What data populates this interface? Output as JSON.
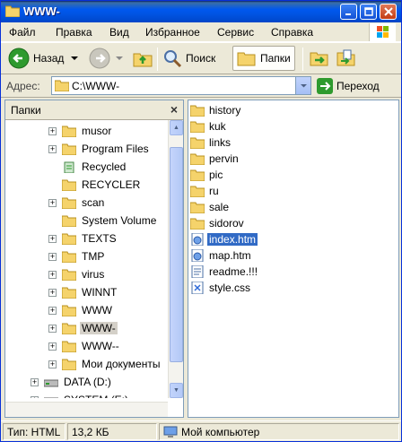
{
  "window": {
    "title": "WWW-"
  },
  "menu": {
    "items": [
      "Файл",
      "Правка",
      "Вид",
      "Избранное",
      "Сервис",
      "Справка"
    ]
  },
  "toolbar": {
    "back_label": "Назад",
    "search_label": "Поиск",
    "folders_label": "Папки"
  },
  "address": {
    "label": "Адрес:",
    "value": "C:\\WWW-",
    "go_label": "Переход"
  },
  "folders_pane": {
    "header": "Папки",
    "tree": [
      {
        "label": "musor",
        "expandable": true,
        "selected": false
      },
      {
        "label": "Program Files",
        "expandable": true,
        "selected": false
      },
      {
        "label": "Recycled",
        "expandable": false,
        "selected": false
      },
      {
        "label": "RECYCLER",
        "expandable": false,
        "selected": false
      },
      {
        "label": "scan",
        "expandable": true,
        "selected": false
      },
      {
        "label": "System Volume",
        "expandable": false,
        "selected": false
      },
      {
        "label": "TEXTS",
        "expandable": true,
        "selected": false
      },
      {
        "label": "TMP",
        "expandable": true,
        "selected": false
      },
      {
        "label": "virus",
        "expandable": true,
        "selected": false
      },
      {
        "label": "WINNT",
        "expandable": true,
        "selected": false
      },
      {
        "label": "WWW",
        "expandable": true,
        "selected": false
      },
      {
        "label": "WWW-",
        "expandable": true,
        "selected": true
      },
      {
        "label": "WWW--",
        "expandable": true,
        "selected": false
      },
      {
        "label": "Мои документы",
        "expandable": true,
        "selected": false
      },
      {
        "label": "DATA (D:)",
        "expandable": true,
        "selected": false
      },
      {
        "label": "SYSTEM (E:)",
        "expandable": true,
        "selected": false
      }
    ]
  },
  "files": [
    {
      "name": "history",
      "type": "folder",
      "selected": false
    },
    {
      "name": "kuk",
      "type": "folder",
      "selected": false
    },
    {
      "name": "links",
      "type": "folder",
      "selected": false
    },
    {
      "name": "pervin",
      "type": "folder",
      "selected": false
    },
    {
      "name": "pic",
      "type": "folder",
      "selected": false
    },
    {
      "name": "ru",
      "type": "folder",
      "selected": false
    },
    {
      "name": "sale",
      "type": "folder",
      "selected": false
    },
    {
      "name": "sidorov",
      "type": "folder",
      "selected": false
    },
    {
      "name": "index.htm",
      "type": "html",
      "selected": true
    },
    {
      "name": "map.htm",
      "type": "html",
      "selected": false
    },
    {
      "name": "readme.!!!",
      "type": "text",
      "selected": false
    },
    {
      "name": "style.css",
      "type": "css",
      "selected": false
    }
  ],
  "status": {
    "type_text": "Тип: HTML",
    "size_text": "13,2 КБ",
    "location_text": "Мой компьютер"
  },
  "colors": {
    "accent": "#316ac5",
    "titlebar": "#0054e3",
    "folder": "#f5d36b"
  }
}
